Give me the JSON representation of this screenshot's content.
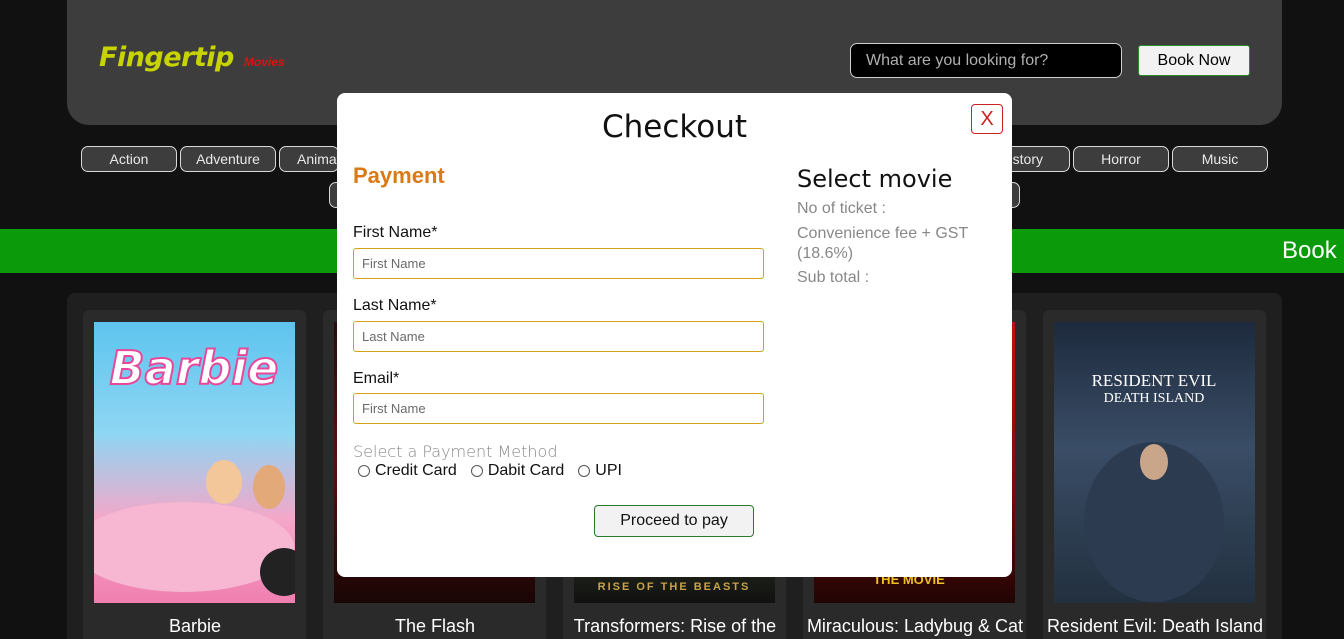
{
  "header": {
    "logo_main": "Fingertip",
    "logo_sub": "Movies",
    "search_placeholder": "What are you looking for?",
    "book_now_label": "Book Now"
  },
  "genres": {
    "action": "Action",
    "adventure": "Adventure",
    "animation": "Animat",
    "history": "istory",
    "horror": "Horror",
    "music": "Music"
  },
  "banner": {
    "text": "Book"
  },
  "movies": [
    {
      "title": "Barbie"
    },
    {
      "title": "The Flash"
    },
    {
      "title": "Transformers: Rise of the"
    },
    {
      "title": "Miraculous: Ladybug & Cat"
    },
    {
      "title": "Resident Evil: Death Island"
    }
  ],
  "posters": {
    "barbie_text": "Barbie",
    "transformers_text": "RISE OF THE BEASTS",
    "miraculous_text": "THE MOVIE",
    "resident_line1": "RESIDENT EVIL",
    "resident_line2": "DEATH ISLAND"
  },
  "modal": {
    "title": "Checkout",
    "close_label": "X",
    "payment_heading": "Payment",
    "first_name_label": "First Name*",
    "first_name_placeholder": "First Name",
    "last_name_label": "Last Name*",
    "last_name_placeholder": "Last Name",
    "email_label": "Email*",
    "email_placeholder": "First Name",
    "payment_method_label": "Select a Payment Method",
    "payment_options": [
      "Credit Card",
      "Dabit Card",
      "UPI"
    ],
    "proceed_label": "Proceed to pay",
    "select_movie_heading": "Select movie",
    "no_of_ticket": "No of ticket :",
    "convenience_fee": "Convenience fee + GST (18.6%)",
    "sub_total": "Sub total :"
  },
  "colors": {
    "logo": "#c8d400",
    "logo_sub": "#e01010",
    "banner": "#0a9a0a",
    "payment_heading": "#d97a14",
    "input_border": "#d4a21a",
    "close": "#cc2222"
  }
}
